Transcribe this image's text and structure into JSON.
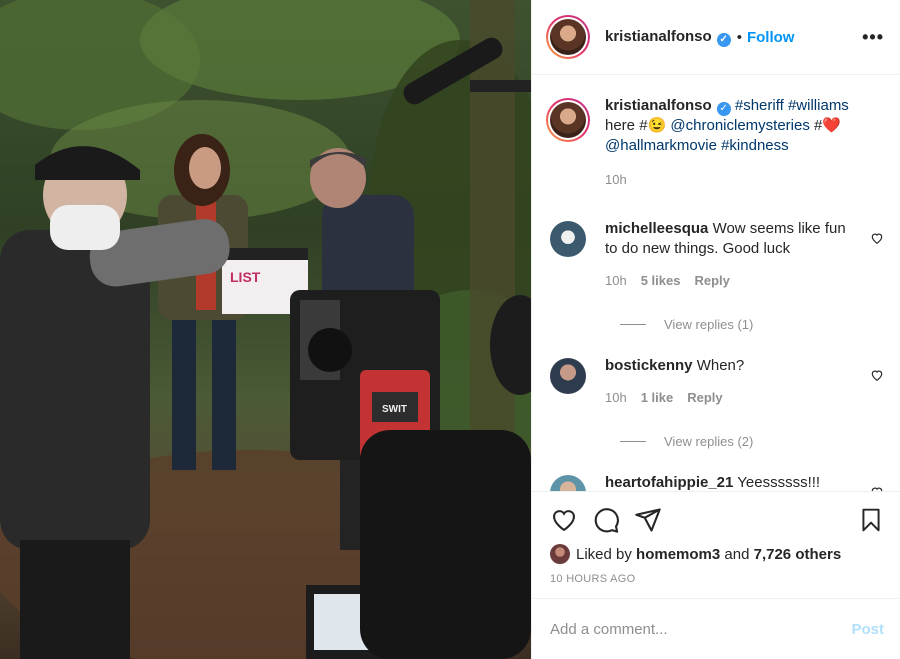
{
  "post": {
    "author": "kristianalfonso",
    "follow_label": "Follow",
    "dot": "•",
    "more_label": "•••",
    "photo_desc": "film crew on forest set"
  },
  "caption": {
    "username": "kristianalfonso",
    "text_parts": [
      "#sheriff",
      "#williams",
      "here #",
      "@chroniclemysteries",
      "#",
      "@hallmarkmovie",
      "#kindness"
    ],
    "time": "10h"
  },
  "comments": [
    {
      "username": "michelleesqua",
      "text": "Wow seems like fun to do new things. Good luck",
      "time": "10h",
      "likes": "5 likes",
      "reply": "Reply",
      "view_replies": "View replies (1)",
      "avatar_color": "#3c5a6e"
    },
    {
      "username": "bostickenny",
      "text": "When?",
      "time": "10h",
      "likes": "1 like",
      "reply": "Reply",
      "view_replies": "View replies (2)",
      "avatar_color": "#2f3b4f"
    },
    {
      "username": "heartofahippie_21",
      "text": "Yeessssss!!!",
      "avatar_color": "#5f93a8"
    }
  ],
  "liked_by": {
    "prefix": "Liked by",
    "user": "homemom3",
    "and": "and",
    "others": "7,726 others"
  },
  "posted_ago": "10 HOURS AGO",
  "add_comment": {
    "placeholder": "Add a comment...",
    "post_label": "Post"
  },
  "colors": {
    "link": "#00376b",
    "follow": "#0095f6",
    "muted": "#8e8e8e",
    "heart": "#ed4956"
  }
}
